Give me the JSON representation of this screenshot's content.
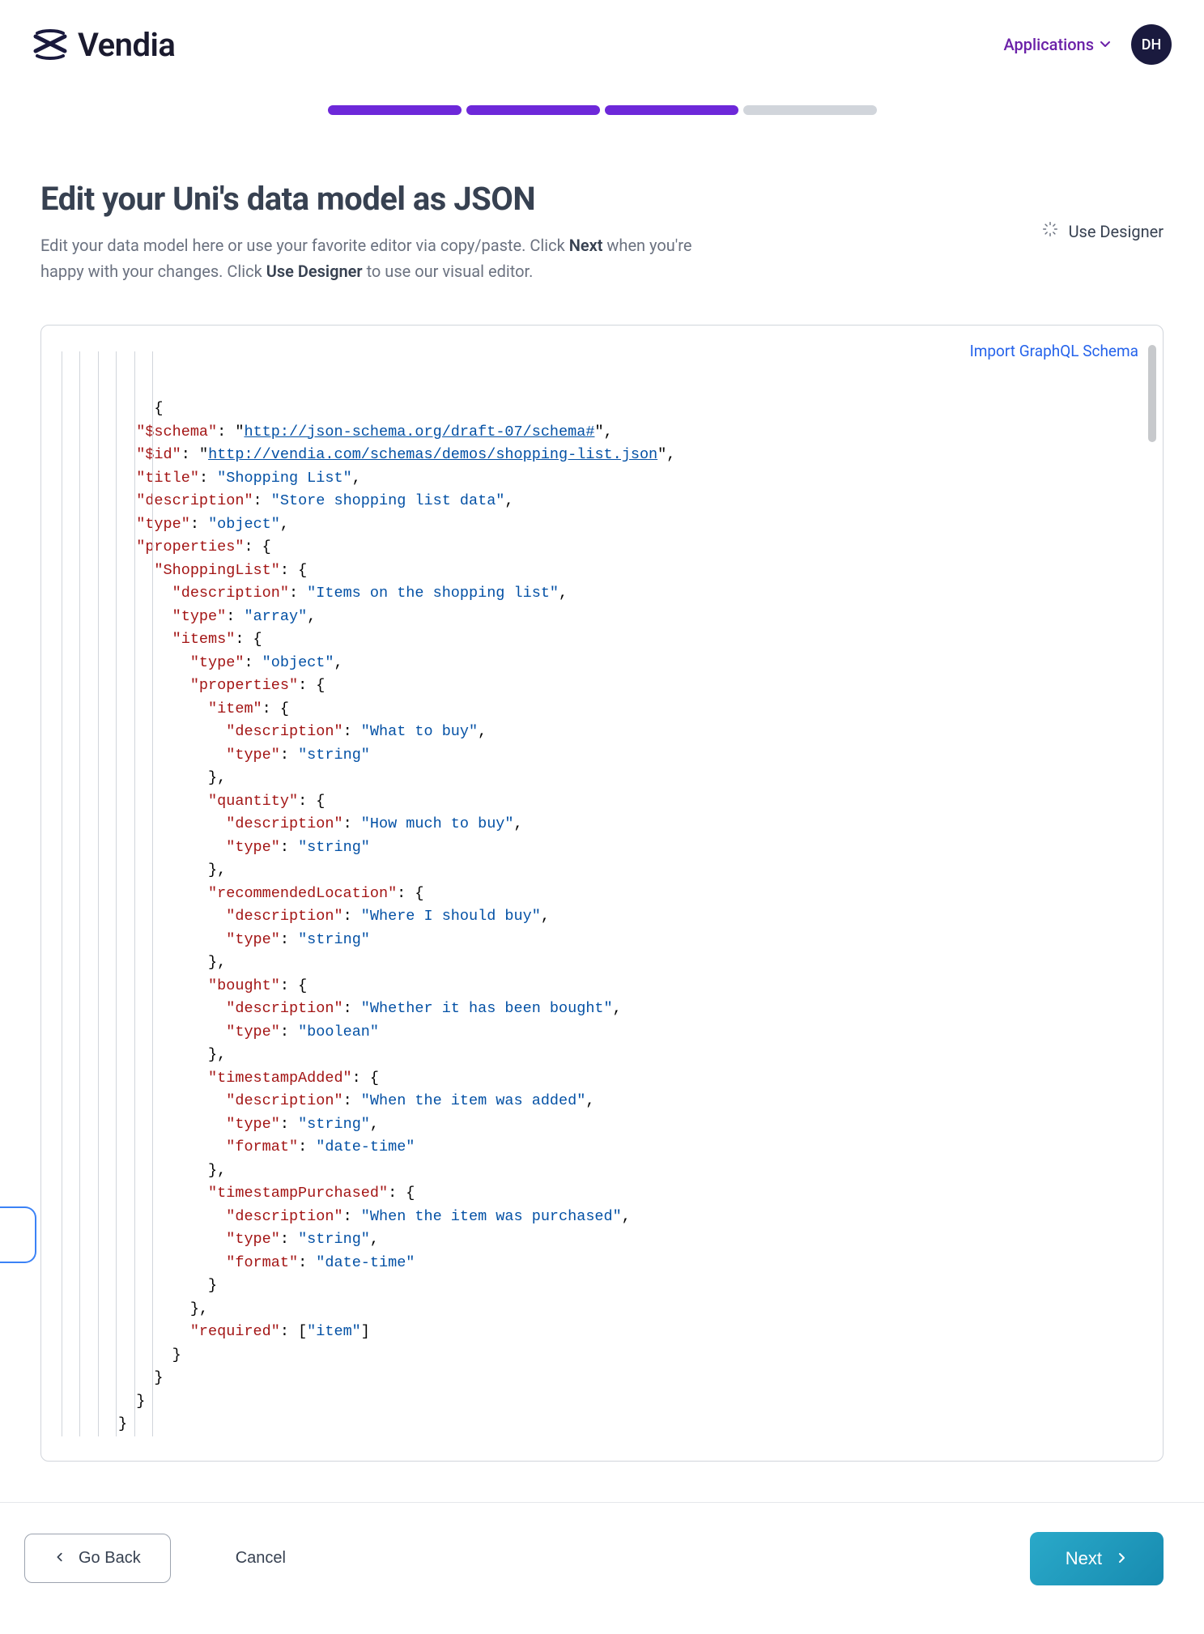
{
  "header": {
    "brand": "Vendia",
    "applications_label": "Applications",
    "avatar_initials": "DH"
  },
  "progress": {
    "current": 3,
    "total": 4
  },
  "page": {
    "title": "Edit your Uni's data model as JSON",
    "desc_pre": "Edit your data model here or use your favorite editor via copy/paste. Click ",
    "desc_bold1": "Next",
    "desc_mid": " when you're happy with your changes. Click ",
    "desc_bold2": "Use Designer",
    "desc_post": " to use our visual editor.",
    "use_designer_label": "Use Designer",
    "import_link": "Import GraphQL Schema"
  },
  "json_schema": {
    "$schema": "http://json-schema.org/draft-07/schema#",
    "$id": "http://vendia.com/schemas/demos/shopping-list.json",
    "title": "Shopping List",
    "description": "Store shopping list data",
    "type": "object",
    "properties": {
      "ShoppingList": {
        "description": "Items on the shopping list",
        "type": "array",
        "items": {
          "type": "object",
          "properties": {
            "item": {
              "description": "What to buy",
              "type": "string"
            },
            "quantity": {
              "description": "How much to buy",
              "type": "string"
            },
            "recommendedLocation": {
              "description": "Where I should buy",
              "type": "string"
            },
            "bought": {
              "description": "Whether it has been bought",
              "type": "boolean"
            },
            "timestampAdded": {
              "description": "When the item was added",
              "type": "string",
              "format": "date-time"
            },
            "timestampPurchased": {
              "description": "When the item was purchased",
              "type": "string",
              "format": "date-time"
            }
          },
          "required": [
            "item"
          ]
        }
      }
    }
  },
  "footer": {
    "back_label": "Go Back",
    "cancel_label": "Cancel",
    "next_label": "Next"
  }
}
